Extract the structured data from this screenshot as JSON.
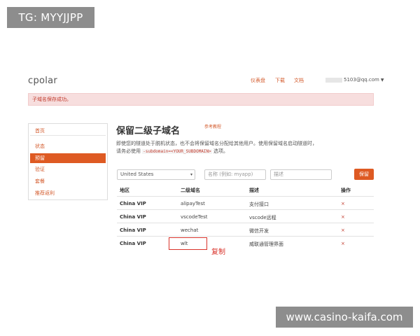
{
  "watermarks": {
    "top": "TG: MYYJJPP",
    "bottom": "www.casino-kaifa.com"
  },
  "header": {
    "logo": "cpolar",
    "nav": [
      "仪表盘",
      "下载",
      "文档"
    ],
    "user_email": "5103@qq.com"
  },
  "alert": "子域名保存成功。",
  "sidebar": {
    "items": [
      "首页",
      "状态",
      "预留",
      "验证",
      "套餐",
      "推荐返利"
    ],
    "active_index": 2
  },
  "main": {
    "title": "保留二级子域名",
    "tutorial_link": "参考教程",
    "desc_1": "即使您的隧道处于脱机状态，也不会将保留域名分配给其他用户。使用保留域名启动隧道时，请务必使用",
    "desc_code": "-subdomain=<YOUR_SUBDOMAIN>",
    "desc_2": "选项。"
  },
  "form": {
    "region_value": "United States",
    "name_placeholder": "名称 (例如: myapp)",
    "desc_placeholder": "描述",
    "submit_label": "保留"
  },
  "table": {
    "headers": [
      "地区",
      "二级域名",
      "描述",
      "操作"
    ],
    "rows": [
      {
        "region": "China VIP",
        "subdomain": "alipayTest",
        "description": "支付接口",
        "action": "×"
      },
      {
        "region": "China VIP",
        "subdomain": "vscodeTest",
        "description": "vscode远程",
        "action": "×"
      },
      {
        "region": "China VIP",
        "subdomain": "wechat",
        "description": "微信开发",
        "action": "×"
      },
      {
        "region": "China VIP",
        "subdomain": "wlt",
        "description": "威联通管理界面",
        "action": "×"
      }
    ]
  },
  "annotation": {
    "label": "复制",
    "color": "#d9332b"
  },
  "colors": {
    "accent": "#de5a23",
    "alert_bg": "#f7dede",
    "alert_text": "#c0392b"
  }
}
